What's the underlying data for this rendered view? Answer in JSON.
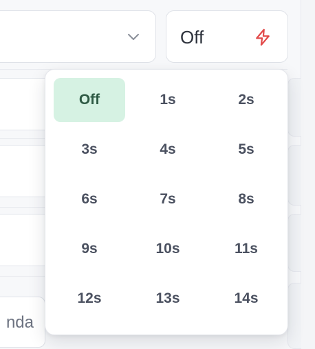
{
  "toggle": {
    "label": "Off",
    "icon": "bolt-icon",
    "icon_color": "#e24b4b"
  },
  "top_select": {
    "icon": "chevron-down-icon"
  },
  "bottom_chip": {
    "text": "nda"
  },
  "dropdown": {
    "selected_color": "#d6f2e3",
    "options": [
      {
        "label": "Off",
        "selected": true
      },
      {
        "label": "1s",
        "selected": false
      },
      {
        "label": "2s",
        "selected": false
      },
      {
        "label": "3s",
        "selected": false
      },
      {
        "label": "4s",
        "selected": false
      },
      {
        "label": "5s",
        "selected": false
      },
      {
        "label": "6s",
        "selected": false
      },
      {
        "label": "7s",
        "selected": false
      },
      {
        "label": "8s",
        "selected": false
      },
      {
        "label": "9s",
        "selected": false
      },
      {
        "label": "10s",
        "selected": false
      },
      {
        "label": "11s",
        "selected": false
      },
      {
        "label": "12s",
        "selected": false
      },
      {
        "label": "13s",
        "selected": false
      },
      {
        "label": "14s",
        "selected": false
      }
    ]
  }
}
